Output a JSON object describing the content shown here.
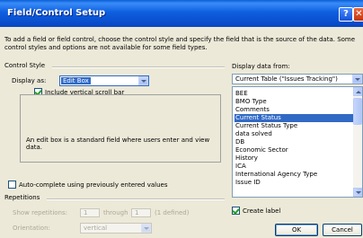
{
  "window": {
    "title": "Field/Control Setup",
    "help_label": "?",
    "close_label": "✕"
  },
  "description": "To add a field or field control, choose the control style and specify the field that is the source of the data. Some control styles and options are not available for some field types.",
  "control_style": {
    "group_label": "Control Style",
    "display_as_label": "Display as:",
    "display_as_value": "Edit Box",
    "vertical_scroll_label": "Include vertical scroll bar",
    "vertical_scroll_checked": true,
    "info_text": "An edit box is a standard field where users enter and view data."
  },
  "display_data": {
    "label": "Display data from:",
    "source_value": "Current Table (\"Issues Tracking\")",
    "fields": [
      "BEE",
      "BMO Type",
      "Comments",
      "Current Status",
      "Current Status Type",
      "data solved",
      "DB",
      "Economic Sector",
      "History",
      "ICA",
      "International Agency Type",
      "Issue ID"
    ],
    "selected_field": "Current Status"
  },
  "auto_complete": {
    "label": "Auto-complete using previously entered values",
    "checked": false
  },
  "repetitions": {
    "group_label": "Repetitions",
    "show_label": "Show repetitions:",
    "from_value": "1",
    "through_label": "through",
    "through_value": "1",
    "defined_text": "(1 defined)",
    "orientation_label": "Orientation:",
    "orientation_value": "vertical"
  },
  "create_label": {
    "label": "Create label",
    "checked": true
  },
  "buttons": {
    "ok": "OK",
    "cancel": "Cancel"
  },
  "colors": {
    "titlebar": "#0a5fd8",
    "selection": "#316ac5",
    "dialog_bg": "#ece9d8"
  }
}
